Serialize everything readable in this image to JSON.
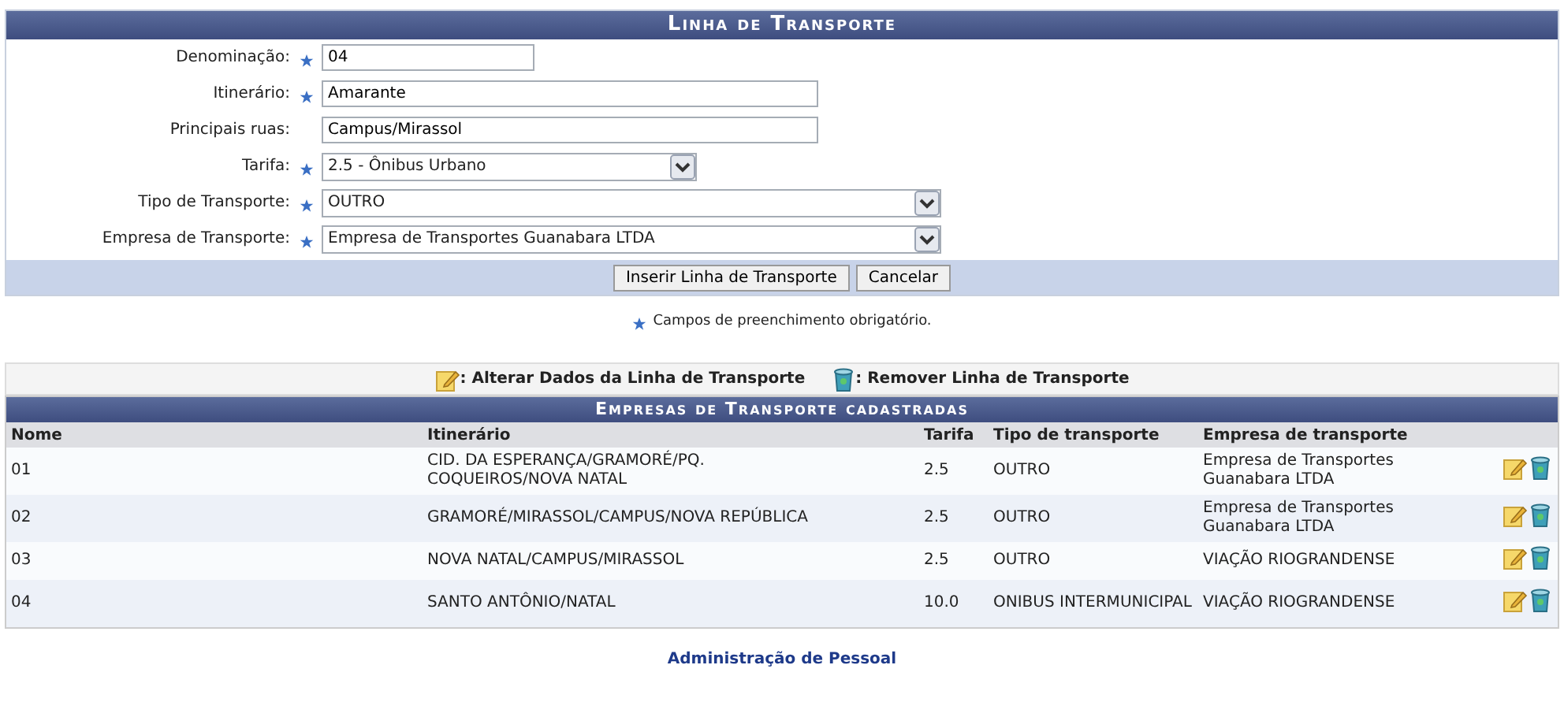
{
  "form": {
    "title": "Linha de Transporte",
    "fields": [
      {
        "kind": "text",
        "label": "Denominação:",
        "required": true,
        "value": "04"
      },
      {
        "kind": "text",
        "label": "Itinerário:",
        "required": true,
        "value": "Amarante"
      },
      {
        "kind": "text",
        "label": "Principais ruas:",
        "required": false,
        "value": "Campus/Mirassol"
      },
      {
        "kind": "select",
        "label": "Tarifa:",
        "required": true,
        "value": "2.5 - Ônibus Urbano"
      },
      {
        "kind": "select",
        "label": "Tipo de Transporte:",
        "required": true,
        "value": "OUTRO"
      },
      {
        "kind": "select",
        "label": "Empresa de Transporte:",
        "required": true,
        "value": "Empresa de Transportes Guanabara LTDA"
      }
    ],
    "buttons": [
      "Inserir Linha de Transporte",
      "Cancelar"
    ],
    "required_note": "Campos de preenchimento obrigatório."
  },
  "legend": {
    "edit": ": Alterar Dados da Linha de Transporte",
    "remove": ": Remover Linha de Transporte"
  },
  "table": {
    "title": "Empresas de Transporte cadastradas",
    "columns": [
      "Nome",
      "Itinerário",
      "Tarifa",
      "Tipo de transporte",
      "Empresa de transporte"
    ],
    "rows": [
      [
        "01",
        "CID. DA ESPERANÇA/GRAMORÉ/PQ. COQUEIROS/NOVA NATAL",
        "2.5",
        "OUTRO",
        "Empresa de Transportes Guanabara LTDA"
      ],
      [
        "02",
        "GRAMORÉ/MIRASSOL/CAMPUS/NOVA REPÚBLICA",
        "2.5",
        "OUTRO",
        "Empresa de Transportes Guanabara LTDA"
      ],
      [
        "03",
        "NOVA NATAL/CAMPUS/MIRASSOL",
        "2.5",
        "OUTRO",
        "VIAÇÃO RIOGRANDENSE"
      ],
      [
        "04",
        "SANTO ANTÔNIO/NATAL",
        "10.0",
        "ONIBUS INTERMUNICIPAL",
        "VIAÇÃO RIOGRANDENSE"
      ]
    ]
  },
  "footer_link": "Administração de Pessoal"
}
